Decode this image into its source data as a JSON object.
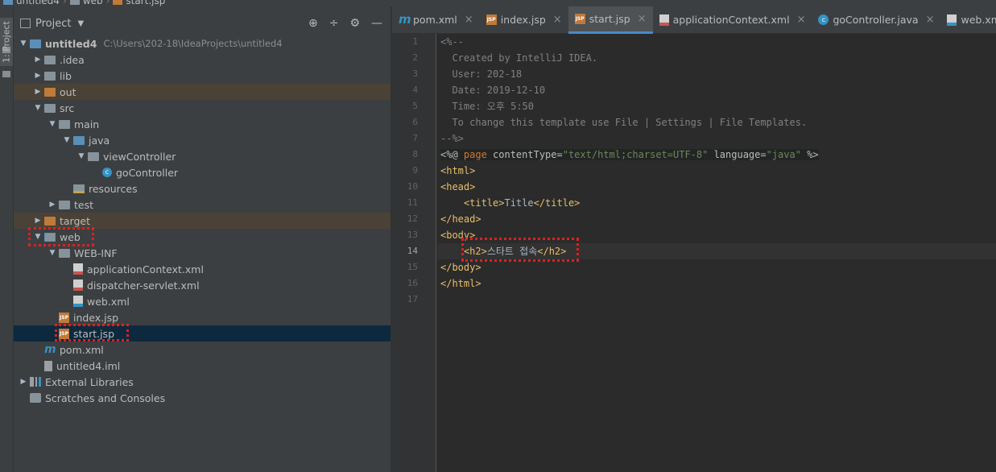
{
  "breadcrumb": [
    "untitled4",
    "web",
    "start.jsp"
  ],
  "stripe": {
    "label": "1: Project"
  },
  "panel": {
    "title": "Project",
    "tools": [
      "⊕",
      "÷",
      "⚙",
      "—"
    ]
  },
  "tree": [
    {
      "label": "untitled4",
      "path": "C:\\Users\\202-18\\IdeaProjects\\untitled4"
    },
    {
      "label": ".idea"
    },
    {
      "label": "lib"
    },
    {
      "label": "out"
    },
    {
      "label": "src"
    },
    {
      "label": "main"
    },
    {
      "label": "java"
    },
    {
      "label": "viewController"
    },
    {
      "label": "goController"
    },
    {
      "label": "resources"
    },
    {
      "label": "test"
    },
    {
      "label": "target"
    },
    {
      "label": "web"
    },
    {
      "label": "WEB-INF"
    },
    {
      "label": "applicationContext.xml"
    },
    {
      "label": "dispatcher-servlet.xml"
    },
    {
      "label": "web.xml"
    },
    {
      "label": "index.jsp"
    },
    {
      "label": "start.jsp"
    },
    {
      "label": "pom.xml"
    },
    {
      "label": "untitled4.iml"
    },
    {
      "label": "External Libraries"
    },
    {
      "label": "Scratches and Consoles"
    }
  ],
  "tabs": [
    {
      "label": "pom.xml",
      "icon": "maven-icon"
    },
    {
      "label": "index.jsp",
      "icon": "jsp-icon"
    },
    {
      "label": "start.jsp",
      "icon": "jsp-icon"
    },
    {
      "label": "applicationContext.xml",
      "icon": "xml-icon"
    },
    {
      "label": "goController.java",
      "icon": "class-icon"
    },
    {
      "label": "web.xml",
      "icon": "xml-icon"
    }
  ],
  "editor": {
    "line_numbers": [
      "1",
      "2",
      "3",
      "4",
      "5",
      "6",
      "7",
      "8",
      "9",
      "10",
      "11",
      "12",
      "13",
      "14",
      "15",
      "16",
      "17"
    ],
    "current_line": "14",
    "lines": {
      "l1": "<%--",
      "l2": "  Created by IntelliJ IDEA.",
      "l3": "  User: 202-18",
      "l4": "  Date: 2019-12-10",
      "l5": "  Time: 오후 5:50",
      "l6": "  To change this template use File | Settings | File Templates.",
      "l7": "--%>",
      "l8_open": "<%@ ",
      "l8_kw": "page",
      "l8_attr1": " contentType=",
      "l8_val1": "\"text/html;charset=UTF-8\"",
      "l8_attr2": " language=",
      "l8_val2": "\"java\"",
      "l8_close": " %>",
      "l9": "<html>",
      "l10": "<head>",
      "l11_open": "<title>",
      "l11_text": "Title",
      "l11_close": "</title>",
      "l12": "</head>",
      "l13": "<body>",
      "l14_open": "<h2>",
      "l14_text": "스타트 접속",
      "l14_close": "</h2>",
      "l15": "</body>",
      "l16": "</html>"
    }
  },
  "colors": {
    "editor_bg": "#2b2b2b",
    "panel_bg": "#3c3f41",
    "selection": "#0d293e",
    "excluded": "#4a4236",
    "tag": "#e8bf6a",
    "string": "#6a8759",
    "comment": "#808080",
    "highlight_box": "#e02020"
  }
}
